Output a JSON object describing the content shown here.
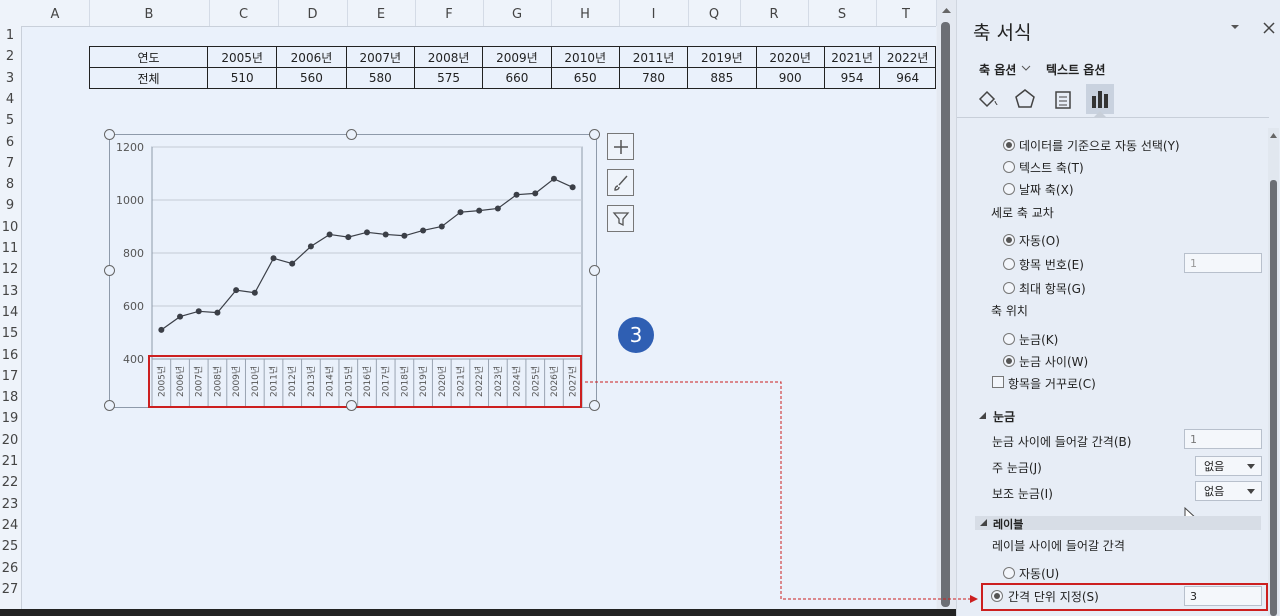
{
  "sheet": {
    "columns": [
      "A",
      "B",
      "C",
      "D",
      "E",
      "F",
      "G",
      "H",
      "I",
      "Q",
      "R",
      "S",
      "T"
    ],
    "rows": [
      "1",
      "2",
      "3",
      "4",
      "5",
      "6",
      "7",
      "8",
      "9",
      "10",
      "11",
      "12",
      "13",
      "14",
      "15",
      "16",
      "17",
      "18",
      "19",
      "20",
      "21",
      "22",
      "23",
      "24",
      "25",
      "26",
      "27"
    ],
    "table": {
      "header_label": "연도",
      "value_label": "전체",
      "years": [
        "2005년",
        "2006년",
        "2007년",
        "2008년",
        "2009년",
        "2010년",
        "2011년",
        "2019년",
        "2020년",
        "2021년",
        "2022년"
      ],
      "values": [
        "510",
        "560",
        "580",
        "575",
        "660",
        "650",
        "780",
        "885",
        "900",
        "954",
        "964"
      ]
    },
    "callout_number": "3"
  },
  "chart_data": {
    "type": "line",
    "categories": [
      "2005년",
      "2006년",
      "2007년",
      "2008년",
      "2009년",
      "2010년",
      "2011년",
      "2012년",
      "2013년",
      "2014년",
      "2015년",
      "2016년",
      "2017년",
      "2018년",
      "2019년",
      "2020년",
      "2021년",
      "2022년",
      "2023년",
      "2024년",
      "2025년",
      "2026년",
      "2027년"
    ],
    "values": [
      510,
      560,
      580,
      575,
      660,
      650,
      780,
      760,
      825,
      870,
      860,
      878,
      870,
      865,
      885,
      900,
      954,
      960,
      968,
      1020,
      1025,
      1080,
      1048
    ],
    "ylim": [
      400,
      1200
    ],
    "yticks": [
      "400",
      "600",
      "800",
      "1000",
      "1200"
    ],
    "grid": true,
    "series_color": "#3b3f47"
  },
  "panel": {
    "title": "축 서식",
    "tab_axis_options": "축 옵션",
    "tab_text_options": "텍스트 옵션",
    "axis_type_opts": [
      "데이터를 기준으로 자동 선택(Y)",
      "텍스트 축(T)",
      "날짜 축(X)"
    ],
    "cross_label": "세로 축 교차",
    "cross_opts": [
      "자동(O)",
      "항목 번호(E)",
      "최대 항목(G)"
    ],
    "cross_value": "1",
    "pos_label": "축 위치",
    "pos_opts": [
      "눈금(K)",
      "눈금 사이(W)"
    ],
    "reverse_label": "항목을 거꾸로(C)",
    "tick_section": "눈금",
    "tick_interval_label": "눈금 사이에 들어갈 간격(B)",
    "tick_interval_value": "1",
    "major_label": "주 눈금(J)",
    "major_value": "없음",
    "minor_label": "보조 눈금(I)",
    "minor_value": "없음",
    "label_section": "레이블",
    "label_interval_label": "레이블 사이에 들어갈 간격",
    "auto_label": "자동(U)",
    "specify_label": "간격 단위 지정(S)",
    "specify_value": "3"
  },
  "colors": {
    "highlight": "#cc1f1f",
    "callout": "#2f5fb3"
  }
}
